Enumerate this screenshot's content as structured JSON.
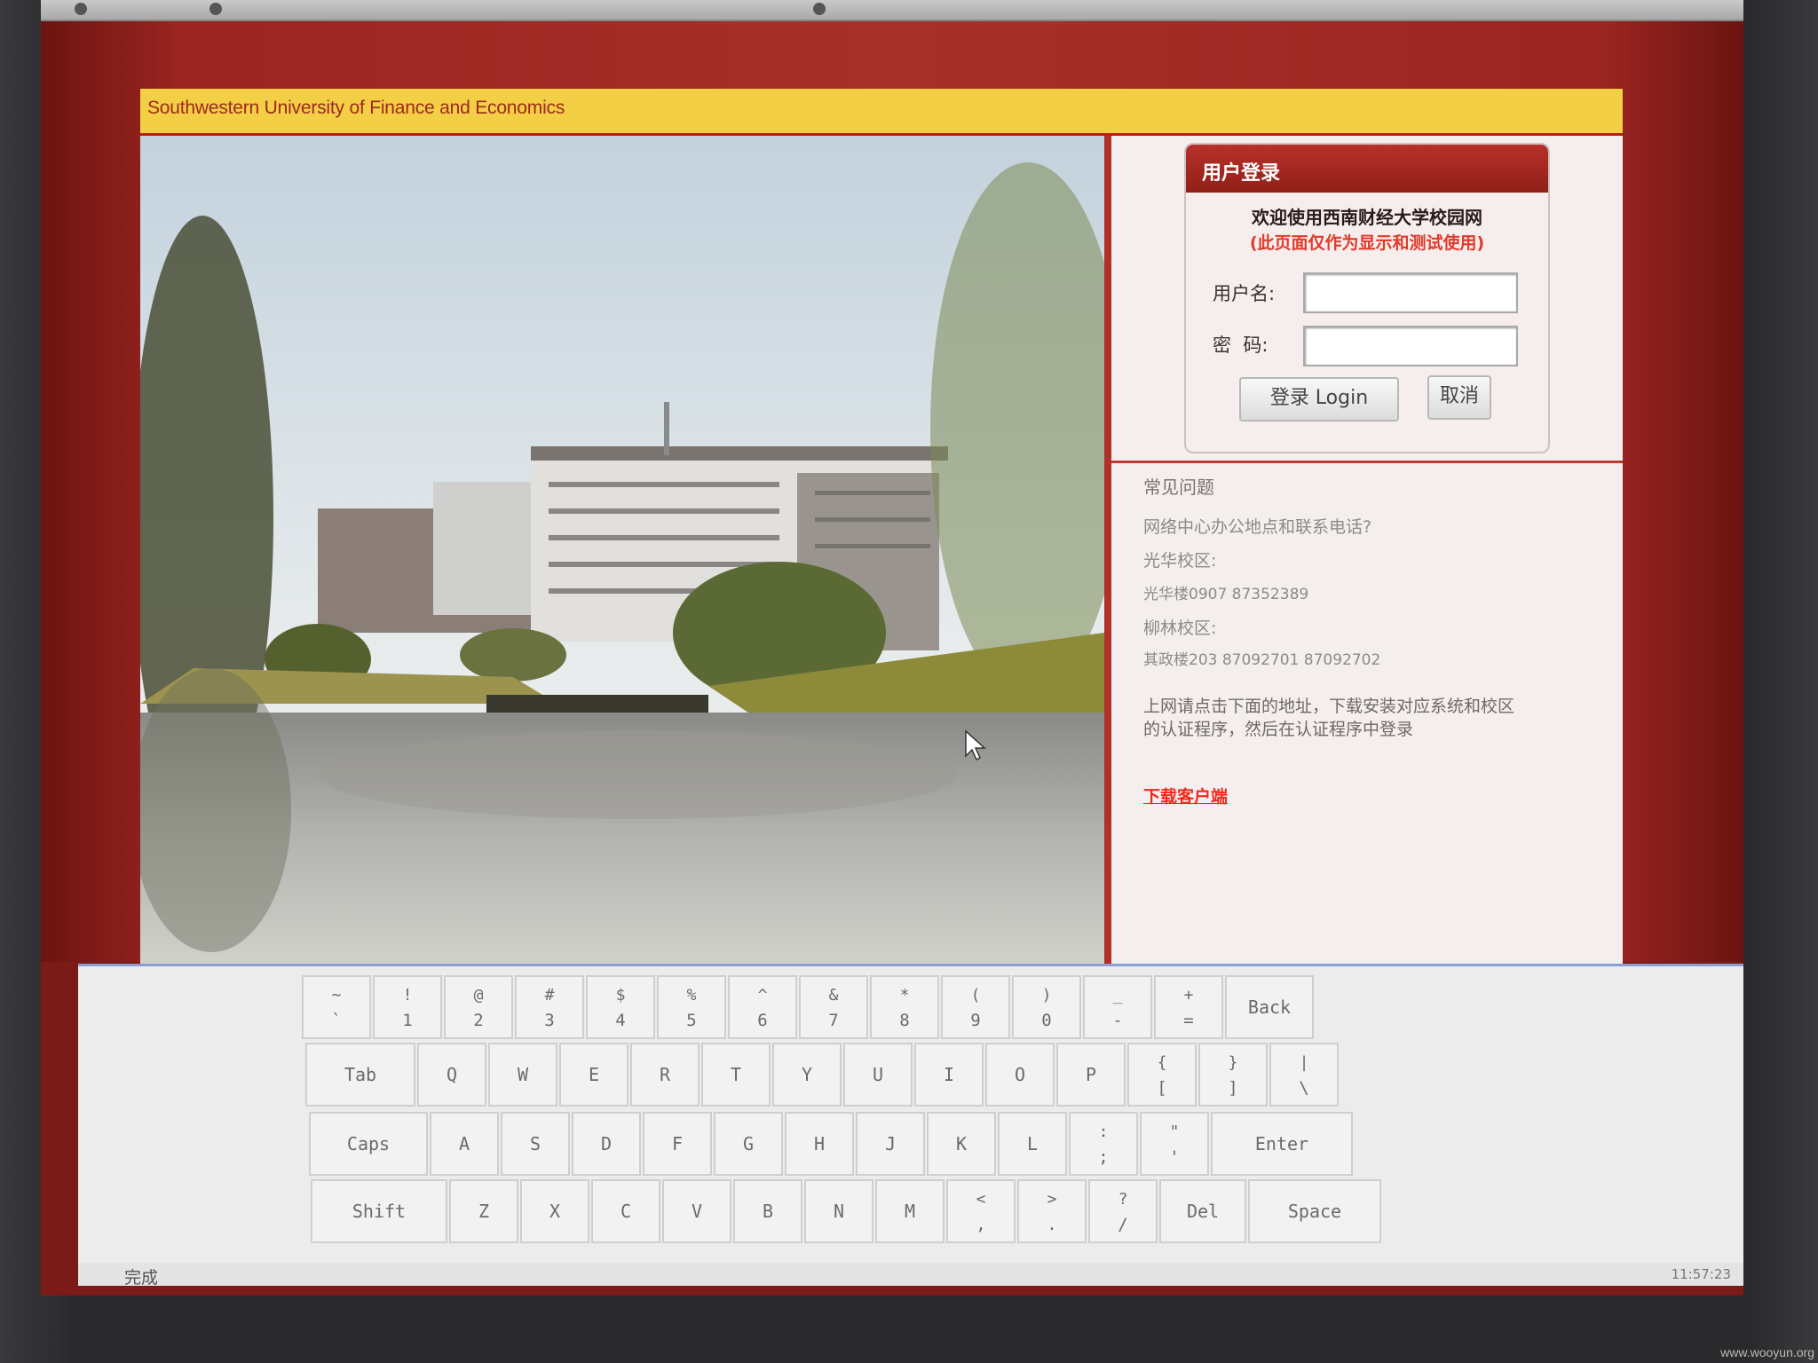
{
  "header": {
    "title": "Southwestern University of Finance and Economics"
  },
  "login": {
    "title": "用户登录",
    "welcome": "欢迎使用西南财经大学校园网",
    "note": "(此页面仅作为显示和测试使用)",
    "username_label": "用户名:",
    "password_label": "密  码:",
    "login_button": "登录 Login",
    "cancel_button": "取消"
  },
  "faq": {
    "heading": "常见问题",
    "lines": [
      "网络中心办公地点和联系电话?",
      "光华校区:",
      "光华楼0907 87352389",
      "柳林校区:",
      "其政楼203 87092701 87092702"
    ],
    "instruction_1": "上网请点击下面的地址，下载安装对应系统和校区",
    "instruction_2": "的认证程序，然后在认证程序中登录",
    "download_link": "下载客户端"
  },
  "keyboard": {
    "row1": [
      {
        "top": "~",
        "bottom": "`"
      },
      {
        "top": "!",
        "bottom": "1"
      },
      {
        "top": "@",
        "bottom": "2"
      },
      {
        "top": "#",
        "bottom": "3"
      },
      {
        "top": "$",
        "bottom": "4"
      },
      {
        "top": "%",
        "bottom": "5"
      },
      {
        "top": "^",
        "bottom": "6"
      },
      {
        "top": "&",
        "bottom": "7"
      },
      {
        "top": "*",
        "bottom": "8"
      },
      {
        "top": "(",
        "bottom": "9"
      },
      {
        "top": ")",
        "bottom": "0"
      },
      {
        "top": "_",
        "bottom": "-"
      },
      {
        "top": "+",
        "bottom": "="
      },
      {
        "label": "Back"
      }
    ],
    "row2": [
      {
        "label": "Tab"
      },
      {
        "label": "Q"
      },
      {
        "label": "W"
      },
      {
        "label": "E"
      },
      {
        "label": "R"
      },
      {
        "label": "T"
      },
      {
        "label": "Y"
      },
      {
        "label": "U"
      },
      {
        "label": "I"
      },
      {
        "label": "O"
      },
      {
        "label": "P"
      },
      {
        "top": "{",
        "bottom": "["
      },
      {
        "top": "}",
        "bottom": "]"
      },
      {
        "top": "|",
        "bottom": "\\"
      }
    ],
    "row3": [
      {
        "label": "Caps"
      },
      {
        "label": "A"
      },
      {
        "label": "S"
      },
      {
        "label": "D"
      },
      {
        "label": "F"
      },
      {
        "label": "G"
      },
      {
        "label": "H"
      },
      {
        "label": "J"
      },
      {
        "label": "K"
      },
      {
        "label": "L"
      },
      {
        "top": ":",
        "bottom": ";"
      },
      {
        "top": "\"",
        "bottom": "'"
      },
      {
        "label": "Enter"
      }
    ],
    "row4": [
      {
        "label": "Shift"
      },
      {
        "label": "Z"
      },
      {
        "label": "X"
      },
      {
        "label": "C"
      },
      {
        "label": "V"
      },
      {
        "label": "B"
      },
      {
        "label": "N"
      },
      {
        "label": "M"
      },
      {
        "top": "<",
        "bottom": ","
      },
      {
        "top": ">",
        "bottom": "."
      },
      {
        "top": "?",
        "bottom": "/"
      },
      {
        "label": "Del"
      },
      {
        "label": "Space"
      }
    ]
  },
  "status": {
    "text": "完成",
    "clock": "11:57:23"
  },
  "watermark": "www.wooyun.org",
  "colors": {
    "header_yellow": "#f2cf45",
    "brand_red": "#a8302a",
    "link_red": "#ef2a1a"
  }
}
